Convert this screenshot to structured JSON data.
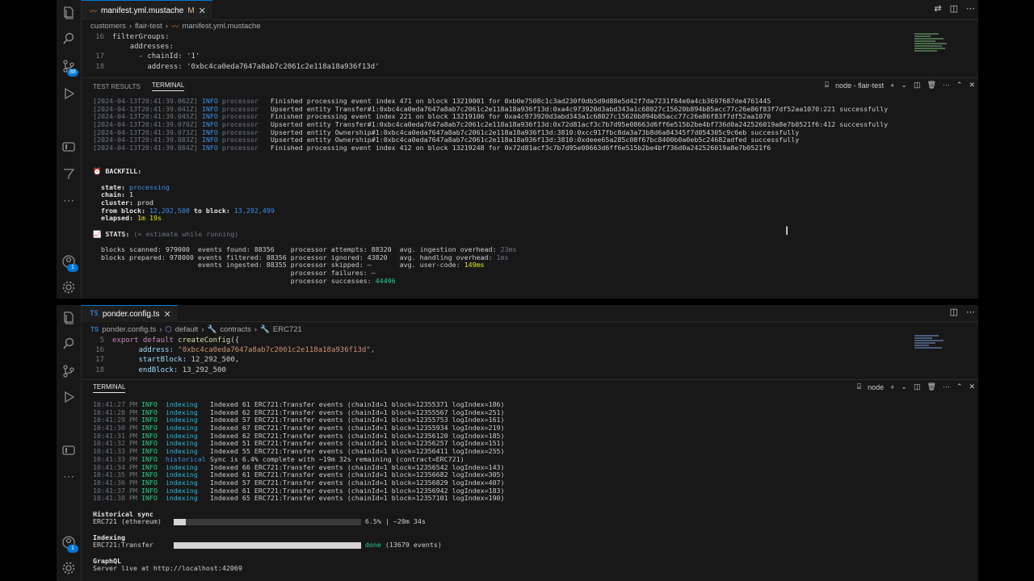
{
  "top": {
    "tab": {
      "icon": "mustache-icon",
      "label": "manifest.yml.mustache",
      "modified": "M"
    },
    "breadcrumb": [
      "customers",
      "flair-test",
      "manifest.yml.mustache"
    ],
    "scm_badge": "88",
    "account_badge": "1",
    "code": [
      {
        "n": "16",
        "t": "filterGroups:"
      },
      {
        "n": "",
        "t": "    addresses:"
      },
      {
        "n": "17",
        "t": "      - chainId: '1'"
      },
      {
        "n": "18",
        "t": "        address: '0xbc4ca0eda7647a8ab7c2061c2e118a18a936f13d'"
      }
    ],
    "panel": {
      "tabs": [
        "TEST RESULTS",
        "TERMINAL"
      ],
      "terminal_name": "node - flair-test",
      "logs": [
        {
          "ts": "[2024-04-13T20:41:39.062Z]",
          "lvl": "INFO",
          "src": "processor",
          "msg": "Finished processing event index 471 on block 13219001 for 0xb0e7508c1c3ad230f0db5d9d88e5d42f7da7231f64e0a4cb3697687de4761445"
        },
        {
          "ts": "[2024-04-13T20:41:39.041Z]",
          "lvl": "INFO",
          "src": "processor",
          "msg": "Upserted entity Transfer#1:0xbc4ca0eda7647a8ab7c2061c2e118a18a936f13d:0xa4c973920d3abd343a1c68027c15620b894b85acc77c26e86f83f7df52aa1070:221 successfully"
        },
        {
          "ts": "[2024-04-13T20:41:39.045Z]",
          "lvl": "INFO",
          "src": "processor",
          "msg": "Finished processing event index 221 on block 13219106 for 0xa4c973920d3abd343a1c68027c15620b894b85acc77c26e86f83f7df52aa1070"
        },
        {
          "ts": "[2024-04-13T20:41:39.070Z]",
          "lvl": "INFO",
          "src": "processor",
          "msg": "Upserted entity Transfer#1:0xbc4ca0eda7647a8ab7c2061c2e118a18a936f13d:0x72d81acf3c7b7d95e08663d6ff6e515b2be4bf736d0a242526019a8e7b0521f6:412 successfully"
        },
        {
          "ts": "[2024-04-13T20:41:39.073Z]",
          "lvl": "INFO",
          "src": "processor",
          "msg": "Upserted entity Ownership#1:0xbc4ca0eda7647a8ab7c2061c2e118a18a936f13d:3810:0xcc917fbc8da3a73b8d6a84345f7d054305c9c6eb successfully"
        },
        {
          "ts": "[2024-04-13T20:41:39.083Z]",
          "lvl": "INFO",
          "src": "processor",
          "msg": "Upserted entity Ownership#1:0xbc4ca0eda7647a8ab7c2061c2e118a18a936f13d:3810:0xdeee65a285c08f67bc8400b0a0eb5c24682adfed successfully"
        },
        {
          "ts": "[2024-04-13T20:41:39.084Z]",
          "lvl": "INFO",
          "src": "processor",
          "msg": "Finished processing event index 412 on block 13219248 for 0x72d81acf3c7b7d95e08663d6ff6e515b2be4bf736d0a242526019a8e7b0521f6"
        }
      ],
      "backfill": {
        "heading": "BACKFILL:",
        "state_label": "state:",
        "state": "processing",
        "chain_label": "chain:",
        "chain": "1",
        "cluster_label": "cluster:",
        "cluster": "prod",
        "from_label": "from block:",
        "from": "12,292,500",
        "to_label": "to block:",
        "to": "13,292,499",
        "elapsed_label": "elapsed:",
        "elapsed": "1m 19s"
      },
      "stats": {
        "heading": "STATS:",
        "note": "(≈ estimate while running)",
        "row1": "blocks scanned: 979000  events found: 88356    processor attempts: 88320  avg. ingestion overhead: ",
        "row1_val": "23ms",
        "row2": "blocks prepared: 978000 events filtered: 88356 processor ignored: 43820   avg. handling overhead: ",
        "row2_val": "1ms",
        "row3": "                        events ingested: 88355 processor skipped: –       avg. user-code: ",
        "row3_val": "149ms",
        "row4": "                                               processor failures: –",
        "row5": "                                               processor successes: ",
        "row5_val": "44496"
      }
    }
  },
  "bottom": {
    "tab": {
      "icon": "TS",
      "label": "ponder.config.ts"
    },
    "breadcrumb": [
      "ponder.config.ts",
      "default",
      "contracts",
      "ERC721"
    ],
    "account_badge": "1",
    "code": [
      {
        "n": "5",
        "pre": "export default ",
        "fn": "createConfig",
        "post": "({"
      },
      {
        "n": "16",
        "key": "address: ",
        "val": "\"0xbc4ca0eda7647a8ab7c2061c2e118a18a936f13d\","
      },
      {
        "n": "17",
        "key": "startBlock: ",
        "val": "12_292_500,"
      },
      {
        "n": "18",
        "key": "endBlock: ",
        "val": "13_292_500"
      }
    ],
    "panel": {
      "tabs": [
        "TERMINAL"
      ],
      "terminal_name": "node",
      "logs": [
        {
          "t": "10:41:27 PM",
          "lvl": "INFO",
          "src": "indexing",
          "msg": "Indexed 61 ERC721:Transfer events (chainId=1 block=12355371 logIndex=186)"
        },
        {
          "t": "10:41:28 PM",
          "lvl": "INFO",
          "src": "indexing",
          "msg": "Indexed 62 ERC721:Transfer events (chainId=1 block=12355567 logIndex=251)"
        },
        {
          "t": "10:41:29 PM",
          "lvl": "INFO",
          "src": "indexing",
          "msg": "Indexed 57 ERC721:Transfer events (chainId=1 block=12355753 logIndex=161)"
        },
        {
          "t": "10:41:30 PM",
          "lvl": "INFO",
          "src": "indexing",
          "msg": "Indexed 67 ERC721:Transfer events (chainId=1 block=12355934 logIndex=219)"
        },
        {
          "t": "10:41:31 PM",
          "lvl": "INFO",
          "src": "indexing",
          "msg": "Indexed 62 ERC721:Transfer events (chainId=1 block=12356120 logIndex=185)"
        },
        {
          "t": "10:41:32 PM",
          "lvl": "INFO",
          "src": "indexing",
          "msg": "Indexed 51 ERC721:Transfer events (chainId=1 block=12356257 logIndex=151)"
        },
        {
          "t": "10:41:33 PM",
          "lvl": "INFO",
          "src": "indexing",
          "msg": "Indexed 55 ERC721:Transfer events (chainId=1 block=12356411 logIndex=255)"
        },
        {
          "t": "10:41:33 PM",
          "lvl": "INFO",
          "src": "historical",
          "msg": "Sync is 6.4% complete with ~19m 32s remaining (contract=ERC721)"
        },
        {
          "t": "10:41:34 PM",
          "lvl": "INFO",
          "src": "indexing",
          "msg": "Indexed 66 ERC721:Transfer events (chainId=1 block=12356542 logIndex=143)"
        },
        {
          "t": "10:41:35 PM",
          "lvl": "INFO",
          "src": "indexing",
          "msg": "Indexed 61 ERC721:Transfer events (chainId=1 block=12356682 logIndex=305)"
        },
        {
          "t": "10:41:36 PM",
          "lvl": "INFO",
          "src": "indexing",
          "msg": "Indexed 57 ERC721:Transfer events (chainId=1 block=12356829 logIndex=407)"
        },
        {
          "t": "10:41:37 PM",
          "lvl": "INFO",
          "src": "indexing",
          "msg": "Indexed 61 ERC721:Transfer events (chainId=1 block=12356942 logIndex=183)"
        },
        {
          "t": "10:41:38 PM",
          "lvl": "INFO",
          "src": "indexing",
          "msg": "Indexed 65 ERC721:Transfer events (chainId=1 block=12357101 logIndex=190)"
        }
      ],
      "historical": {
        "heading": "Historical sync",
        "name": "ERC721 (ethereum)",
        "progress": 0.065,
        "status": "6.5% | ~20m 34s"
      },
      "indexing": {
        "heading": "Indexing",
        "name": "ERC721:Transfer",
        "progress": 1.0,
        "done": "done",
        "status": "(13679 events)"
      },
      "graphql": {
        "heading": "GraphQL",
        "status": "Server live at http://localhost:42069"
      }
    }
  },
  "colors": {
    "accent": "#0078d4",
    "info": "#3b8eea",
    "success": "#23d18b",
    "warn": "#e5e510"
  }
}
